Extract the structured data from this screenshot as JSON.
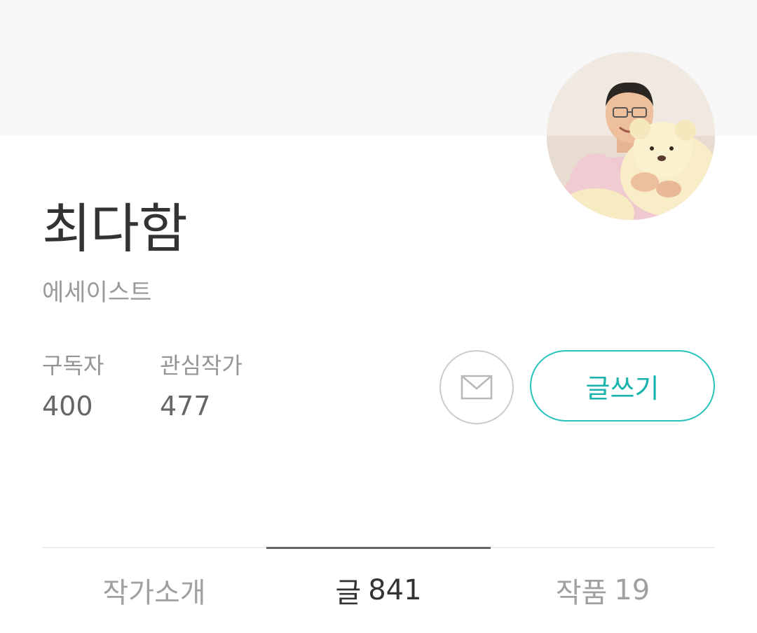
{
  "profile": {
    "name": "최다함",
    "job": "에세이스트"
  },
  "stats": {
    "subscribers": {
      "label": "구독자",
      "value": "400"
    },
    "following": {
      "label": "관심작가",
      "value": "477"
    }
  },
  "actions": {
    "mail_icon": "envelope-icon",
    "write_label": "글쓰기"
  },
  "tabs": [
    {
      "label": "작가소개",
      "count": ""
    },
    {
      "label": "글",
      "count": "841"
    },
    {
      "label": "작품",
      "count": "19"
    }
  ],
  "colors": {
    "accent": "#27c2bb",
    "cover": "#f7f7f7"
  }
}
